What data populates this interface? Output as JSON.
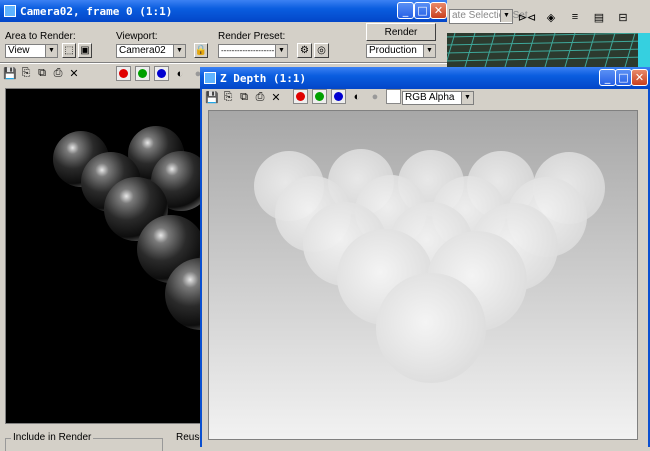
{
  "render_window": {
    "title": "Camera02, frame 0 (1:1)",
    "area_to_render_label": "Area to Render:",
    "area_value": "View",
    "viewport_label": "Viewport:",
    "viewport_value": "Camera02",
    "render_preset_label": "Render Preset:",
    "render_preset_value": "--------------------",
    "render_button": "Render",
    "preset_mode": "Production",
    "include_label": "Include in Render",
    "reuse_label": "Reuse"
  },
  "zdepth_window": {
    "title": "Z Depth (1:1)",
    "channel_value": "RGB Alpha"
  },
  "background_app": {
    "selection_set": "ate Selection Set"
  },
  "colors": {
    "title_bar": "#0a5ddf",
    "red": "#e00000",
    "green": "#00a000",
    "blue": "#0000d0",
    "viewport_teal": "#3ea79a"
  }
}
